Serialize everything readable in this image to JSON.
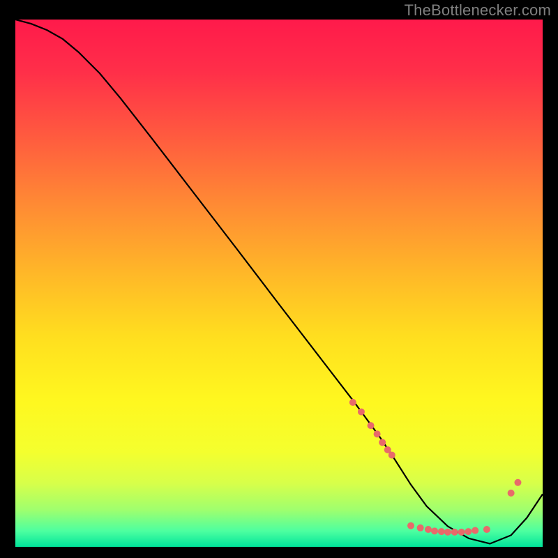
{
  "attribution": "TheBottlenecker.com",
  "chart_data": {
    "type": "line",
    "title": "",
    "xlabel": "",
    "ylabel": "",
    "xlim": [
      0,
      100
    ],
    "ylim": [
      0,
      100
    ],
    "background_gradient_stops": [
      {
        "offset": 0.0,
        "color": "#ff1a4b"
      },
      {
        "offset": 0.1,
        "color": "#ff2f49"
      },
      {
        "offset": 0.22,
        "color": "#ff5a3f"
      },
      {
        "offset": 0.35,
        "color": "#ff8a34"
      },
      {
        "offset": 0.48,
        "color": "#ffb728"
      },
      {
        "offset": 0.6,
        "color": "#ffde1f"
      },
      {
        "offset": 0.72,
        "color": "#fff71f"
      },
      {
        "offset": 0.82,
        "color": "#f4ff2e"
      },
      {
        "offset": 0.88,
        "color": "#d7ff4a"
      },
      {
        "offset": 0.93,
        "color": "#9fff6e"
      },
      {
        "offset": 0.97,
        "color": "#4dffa0"
      },
      {
        "offset": 1.0,
        "color": "#00e49a"
      }
    ],
    "series": [
      {
        "name": "curve",
        "color": "#000000",
        "stroke_width": 2.2,
        "x": [
          0.0,
          3.0,
          6.0,
          9.0,
          12.0,
          16.0,
          20.0,
          26.0,
          34.0,
          42.0,
          50.0,
          58.0,
          64.0,
          69.0,
          72.0,
          75.0,
          78.0,
          82.0,
          86.0,
          90.0,
          94.0,
          97.0,
          100.0
        ],
        "y": [
          100.0,
          99.2,
          98.0,
          96.3,
          93.8,
          89.8,
          85.0,
          77.3,
          66.9,
          56.5,
          46.0,
          35.6,
          27.8,
          21.0,
          16.5,
          11.8,
          7.7,
          3.9,
          1.6,
          0.6,
          2.2,
          5.5,
          10.0
        ]
      }
    ],
    "scatter": [
      {
        "x": 64.0,
        "y": 27.4,
        "r": 5
      },
      {
        "x": 65.6,
        "y": 25.6,
        "r": 5
      },
      {
        "x": 67.4,
        "y": 23.0,
        "r": 5
      },
      {
        "x": 68.6,
        "y": 21.4,
        "r": 5
      },
      {
        "x": 69.6,
        "y": 19.8,
        "r": 5
      },
      {
        "x": 70.6,
        "y": 18.4,
        "r": 5
      },
      {
        "x": 71.4,
        "y": 17.4,
        "r": 5
      },
      {
        "x": 75.0,
        "y": 4.0,
        "r": 5
      },
      {
        "x": 76.8,
        "y": 3.6,
        "r": 5
      },
      {
        "x": 78.3,
        "y": 3.3,
        "r": 5
      },
      {
        "x": 79.5,
        "y": 3.0,
        "r": 5
      },
      {
        "x": 80.8,
        "y": 2.9,
        "r": 5
      },
      {
        "x": 82.0,
        "y": 2.8,
        "r": 5
      },
      {
        "x": 83.3,
        "y": 2.8,
        "r": 5
      },
      {
        "x": 84.6,
        "y": 2.8,
        "r": 5
      },
      {
        "x": 85.9,
        "y": 2.9,
        "r": 5
      },
      {
        "x": 87.2,
        "y": 3.1,
        "r": 5
      },
      {
        "x": 89.4,
        "y": 3.3,
        "r": 5
      },
      {
        "x": 94.0,
        "y": 10.2,
        "r": 5
      },
      {
        "x": 95.3,
        "y": 12.2,
        "r": 5
      }
    ],
    "scatter_color": "#e86a6a"
  }
}
